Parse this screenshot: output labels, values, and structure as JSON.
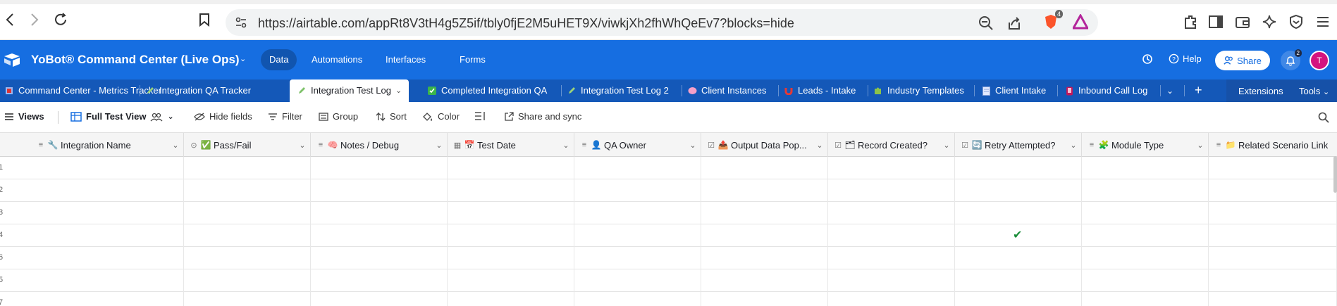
{
  "browser": {
    "url": "https://airtable.com/appRt8V3tH4g5Z5if/tbly0fjE2M5uHET9X/viwkjXh2fhWhQeEv7?blocks=hide",
    "shield_badge": "4",
    "icons": [
      "back-icon",
      "forward-icon",
      "reload-icon",
      "bookmark-icon",
      "site-settings-icon",
      "zoom-out-icon",
      "share-page-icon",
      "brave-shield-icon",
      "brave-rewards-icon",
      "extensions-icon",
      "sidebar-icon",
      "wallet-icon",
      "leo-ai-icon",
      "vpn-icon",
      "menu-icon"
    ]
  },
  "app": {
    "base_name": "YoBot® Command Center (Live Ops)",
    "tabs": [
      {
        "label": "Data",
        "active": true
      },
      {
        "label": "Automations",
        "active": false
      },
      {
        "label": "Interfaces",
        "active": false
      },
      {
        "label": "Forms",
        "active": false
      }
    ],
    "help_label": "Help",
    "share_label": "Share",
    "notification_count": "2",
    "avatar_initial": "T",
    "brand_color": "#166ee1"
  },
  "tables": {
    "items": [
      {
        "label": "Command Center - Metrics Tracker",
        "icon": "sheet-icon"
      },
      {
        "label": "Integration QA Tracker",
        "icon": "pencil-icon"
      },
      {
        "label": "Integration Test Log",
        "icon": "pencil-icon",
        "active": true
      },
      {
        "label": "Completed Integration QA",
        "icon": "checkbox-icon"
      },
      {
        "label": "Integration Test Log 2",
        "icon": "pencil-icon"
      },
      {
        "label": "Client Instances",
        "icon": "brain-icon"
      },
      {
        "label": "Leads - Intake",
        "icon": "magnet-icon"
      },
      {
        "label": "Industry Templates",
        "icon": "puzzle-icon"
      },
      {
        "label": "Client Intake",
        "icon": "document-icon"
      },
      {
        "label": "Inbound Call Log",
        "icon": "phone-icon"
      }
    ],
    "extensions_label": "Extensions",
    "tools_label": "Tools"
  },
  "toolbar": {
    "views_label": "Views",
    "view_name": "Full Test View",
    "hide_fields": "Hide fields",
    "filter": "Filter",
    "group": "Group",
    "sort": "Sort",
    "color": "Color",
    "share_sync": "Share and sync"
  },
  "grid": {
    "columns": [
      {
        "label": "Integration Name",
        "type_icon": "long-text-icon",
        "emoji": "🔧"
      },
      {
        "label": "Pass/Fail",
        "type_icon": "single-select-icon",
        "emoji": "✅"
      },
      {
        "label": "Notes / Debug",
        "type_icon": "long-text-icon",
        "emoji": "🧠"
      },
      {
        "label": "Test Date",
        "type_icon": "date-icon",
        "emoji": "📅"
      },
      {
        "label": "QA Owner",
        "type_icon": "long-text-icon",
        "emoji": "👤"
      },
      {
        "label": "Output Data Pop...",
        "type_icon": "checkbox-icon",
        "emoji": "📤"
      },
      {
        "label": "Record Created?",
        "type_icon": "checkbox-icon",
        "emoji": "🗂"
      },
      {
        "label": "Retry Attempted?",
        "type_icon": "checkbox-icon",
        "emoji": "🔄"
      },
      {
        "label": "Module Type",
        "type_icon": "long-text-icon",
        "emoji": "🧩"
      },
      {
        "label": "Related Scenario Link",
        "type_icon": "long-text-icon",
        "emoji": "📁"
      }
    ],
    "rows": [
      {
        "num": "1",
        "retry_attempted": false
      },
      {
        "num": "2",
        "retry_attempted": false
      },
      {
        "num": "3",
        "retry_attempted": false
      },
      {
        "num": "4",
        "retry_attempted": true
      },
      {
        "num": "6",
        "retry_attempted": false
      },
      {
        "num": "5",
        "retry_attempted": false
      },
      {
        "num": "7",
        "retry_attempted": false
      }
    ],
    "check_color": "#1b8e3a"
  }
}
